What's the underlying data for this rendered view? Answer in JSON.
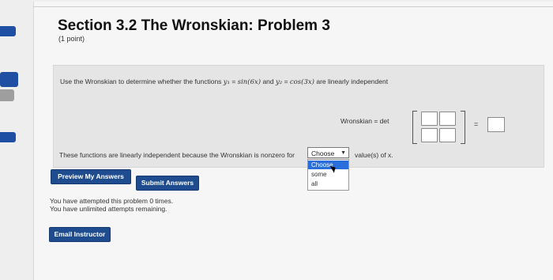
{
  "header": {
    "title": "Section 3.2 The Wronskian: Problem 3",
    "points": "(1 point)"
  },
  "problem": {
    "question_prefix": "Use the Wronskian to determine whether the functions ",
    "y1_label": "y₁",
    "eq1": " = ",
    "f1": "sin(6x)",
    "and": " and ",
    "y2_label": "y₂",
    "eq2": " = ",
    "f2": "cos(3x)",
    "question_suffix": " are linearly independent",
    "wronskian_label": "Wronskian = det",
    "equals": "=",
    "reason_prefix": "These functions are linearly independent because the Wronskian is nonzero for",
    "reason_suffix": "value(s) of x.",
    "select": {
      "value": "Choose",
      "options": [
        "Choose",
        "some",
        "all"
      ]
    }
  },
  "buttons": {
    "preview": "Preview My Answers",
    "submit": "Submit Answers",
    "email": "Email Instructor"
  },
  "status": {
    "attempts": "You have attempted this problem 0 times.",
    "remaining": "You have unlimited attempts remaining."
  },
  "colors": {
    "accent": "#1e4fa3",
    "button": "#1f4c8f",
    "dropdown_highlight": "#2a6edc"
  }
}
